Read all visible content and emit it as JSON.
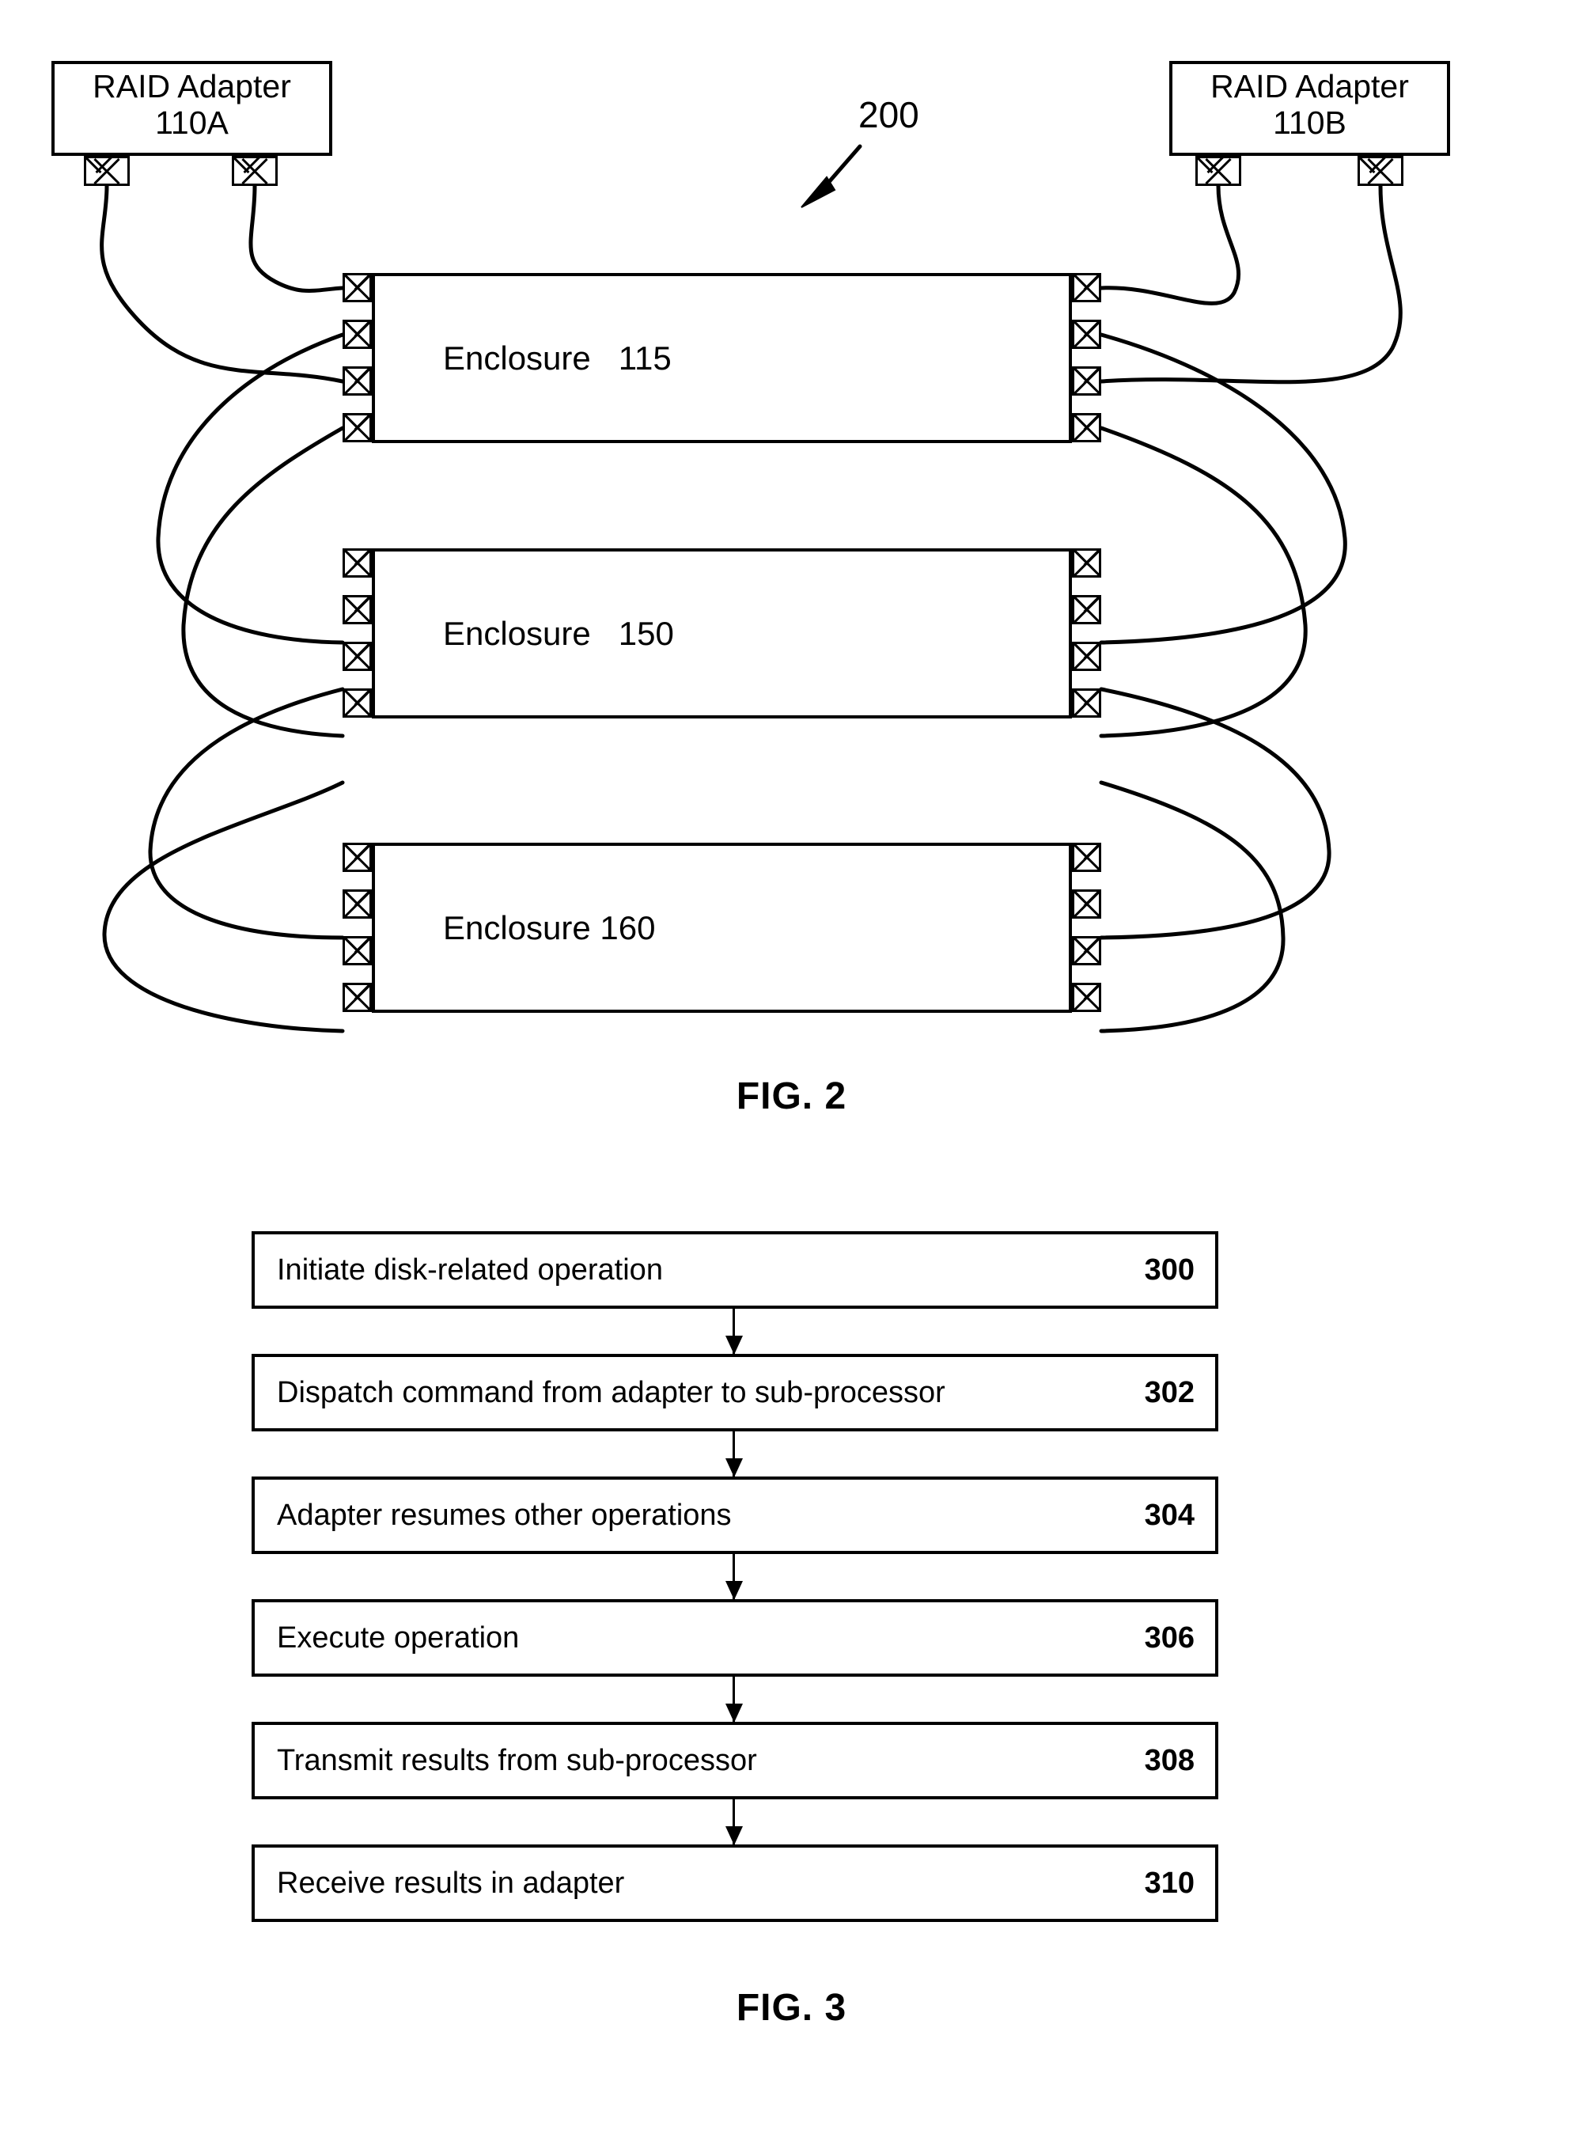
{
  "figures": {
    "fig2": {
      "caption": "FIG. 2",
      "ref_label": "200",
      "adapters": [
        {
          "id": "110A",
          "line1": "RAID Adapter",
          "line2": "110A",
          "side": "left",
          "ports": 2
        },
        {
          "id": "110B",
          "line1": "RAID Adapter",
          "line2": "110B",
          "side": "right",
          "ports": 2
        }
      ],
      "enclosures": [
        {
          "label": "Enclosure   115",
          "name": "Enclosure",
          "number": "115",
          "left_ports": 4,
          "right_ports": 4
        },
        {
          "label": "Enclosure   150",
          "name": "Enclosure",
          "number": "150",
          "left_ports": 4,
          "right_ports": 4
        },
        {
          "label": "Enclosure 160",
          "name": "Enclosure",
          "number": "160",
          "left_ports": 4,
          "right_ports": 4
        }
      ]
    },
    "fig3": {
      "caption": "FIG. 3",
      "steps": [
        {
          "text": "Initiate disk-related operation",
          "number": "300"
        },
        {
          "text": "Dispatch command from adapter to sub-processor",
          "number": "302"
        },
        {
          "text": "Adapter resumes other operations",
          "number": "304"
        },
        {
          "text": "Execute operation",
          "number": "306"
        },
        {
          "text": "Transmit results from sub-processor",
          "number": "308"
        },
        {
          "text": "Receive results in adapter",
          "number": "310"
        }
      ]
    }
  },
  "colors": {
    "ink": "#000000",
    "paper": "#ffffff"
  }
}
